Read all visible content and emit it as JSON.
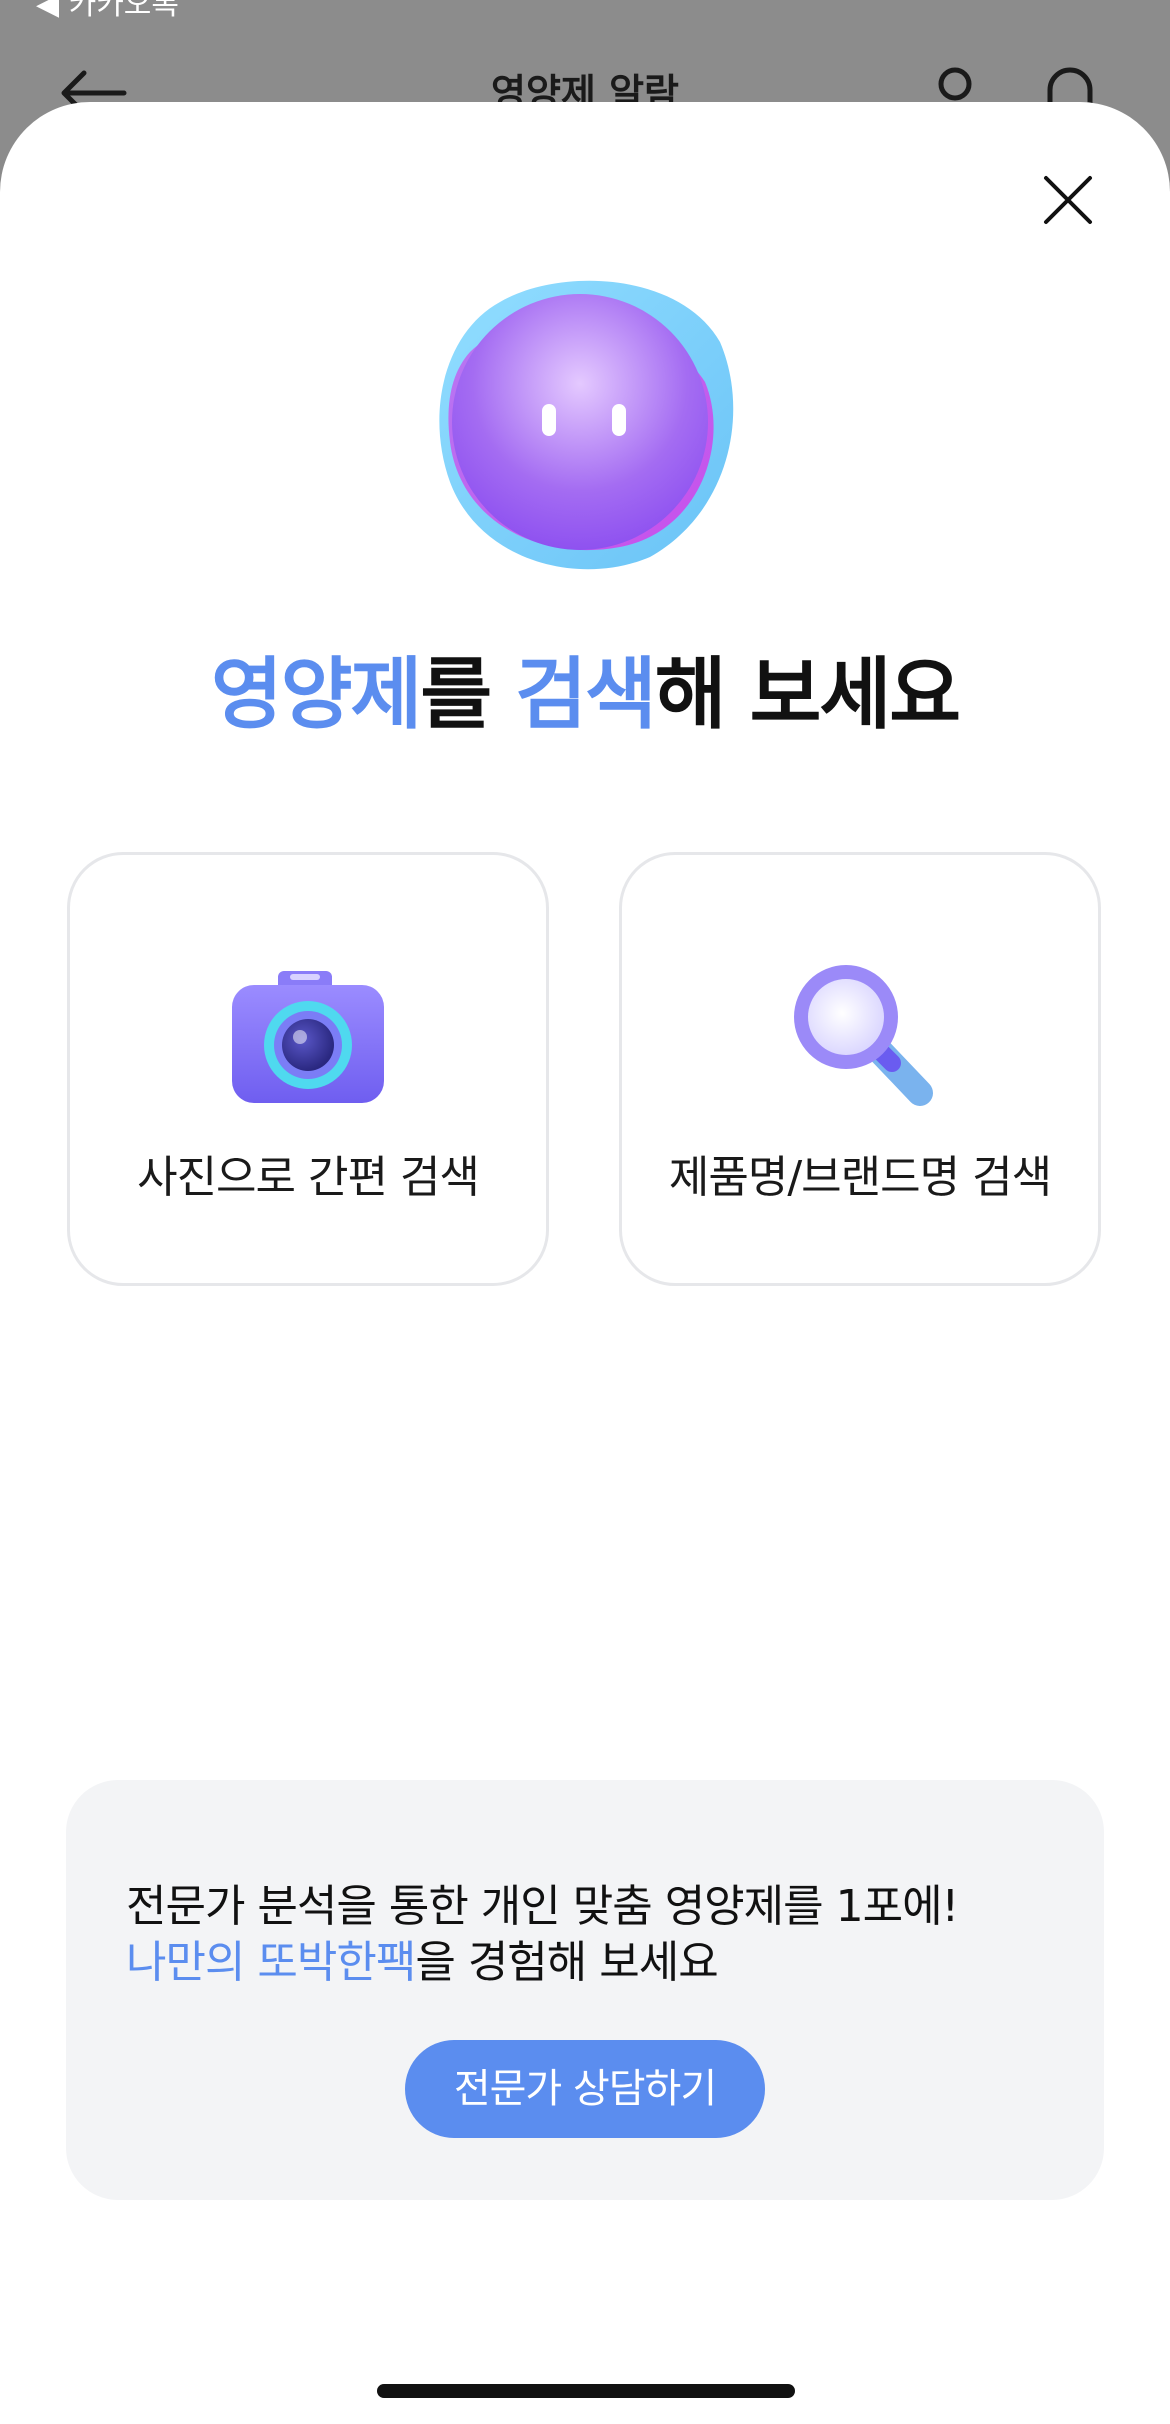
{
  "status_bar": {
    "back_app": "◀ 카카오톡"
  },
  "background_header": {
    "title": "영양제 알람"
  },
  "sheet": {
    "headline": {
      "part1": "영양제",
      "part2": "를 ",
      "part3": "검색",
      "part4": "해 보세요"
    },
    "options": [
      {
        "label": "사진으로 간편 검색",
        "icon": "camera-icon"
      },
      {
        "label": "제품명/브랜드명 검색",
        "icon": "magnifier-icon"
      }
    ],
    "promo": {
      "line1": "전문가 분석을 통한 개인 맞춤 영양제를 1포에!",
      "line2_highlight": "나만의 또박한팩",
      "line2_rest": "을 경험해 보세요",
      "button_label": "전문가 상담하기"
    }
  },
  "colors": {
    "accent": "#5b8def",
    "card_border": "#e6e7ea",
    "promo_bg": "#f3f4f6",
    "backdrop": "#8a8a8a"
  }
}
